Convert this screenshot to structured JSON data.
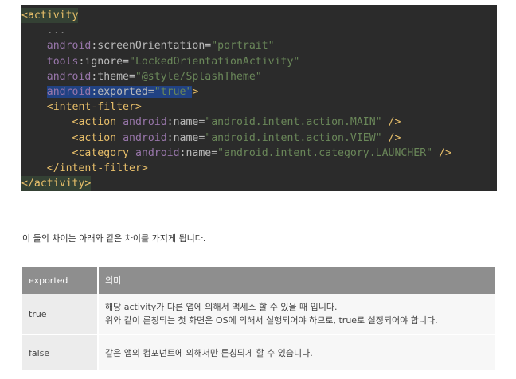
{
  "code": {
    "lines": [
      "<activity",
      "    ...",
      "    android:screenOrientation=\"portrait\"",
      "    tools:ignore=\"LockedOrientationActivity\"",
      "    android:theme=\"@style/SplashTheme\"",
      "    android:exported=\"true\">",
      "    <intent-filter>",
      "        <action android:name=\"android.intent.action.MAIN\" />",
      "        <action android:name=\"android.intent.action.VIEW\" />",
      "        <category android:name=\"android.intent.category.LAUNCHER\" />",
      "    </intent-filter>",
      "</activity>"
    ]
  },
  "intro_text": "이 둘의 차이는 아래와 같은 차이를 가지게 됩니다.",
  "table": {
    "headers": [
      "exported",
      "의미"
    ],
    "rows": [
      {
        "key": "true",
        "desc_lines": [
          "해당 activity가 다른 앱에 의해서 액세스 할 수 있을 때 입니다.",
          "위와 같이 론칭되는 첫 화면은 OS에 의해서 실행되어야 하므로, true로 설정되어야 합니다."
        ]
      },
      {
        "key": "false",
        "desc_lines": [
          "같은 앱의 컴포넌트에 의해서만 론칭되게 할 수 있습니다."
        ]
      }
    ]
  }
}
